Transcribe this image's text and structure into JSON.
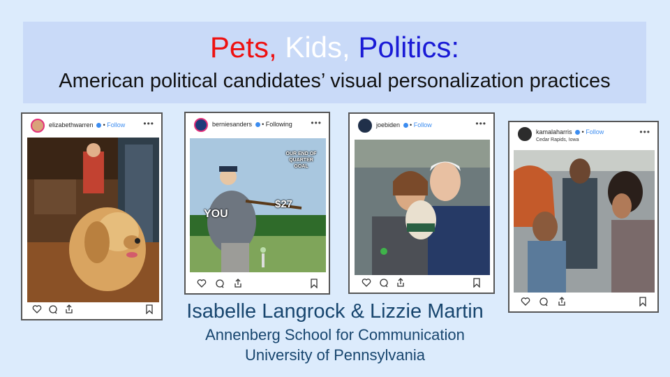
{
  "slide": {
    "title_words": [
      {
        "text": "Pets,",
        "color": "#ee1111"
      },
      {
        "text": "Kids,",
        "color": "#ffffff"
      },
      {
        "text": "Politics:",
        "color": "#1a1ad6"
      }
    ],
    "subtitle": "American political candidates’ visual personalization practices",
    "authors": "Isabelle Langrock & Lizzie Martin",
    "school": "Annenberg School for Communication",
    "university": "University of Pennsylvania"
  },
  "posts": [
    {
      "username": "elizabethwarren",
      "follow_label": "Follow",
      "more": "•••",
      "photo": "golden retriever dog in kitchen"
    },
    {
      "username": "berniesanders",
      "follow_label": "Following",
      "more": "•••",
      "photo": "baseball meme",
      "meme": {
        "caption": "OUR END OF QUARTER GOAL",
        "batter_label": "YOU",
        "bat_label": "$27"
      }
    },
    {
      "username": "joebiden",
      "follow_label": "Follow",
      "more": "•••",
      "photo": "man with dog and woman"
    },
    {
      "username": "kamalaharris",
      "follow_label": "Follow",
      "more": "•••",
      "location": "Cedar Rapids, Iowa",
      "photo": "crowd with child"
    }
  ],
  "icons": [
    "heart-icon",
    "comment-icon",
    "share-icon",
    "bookmark-icon"
  ]
}
